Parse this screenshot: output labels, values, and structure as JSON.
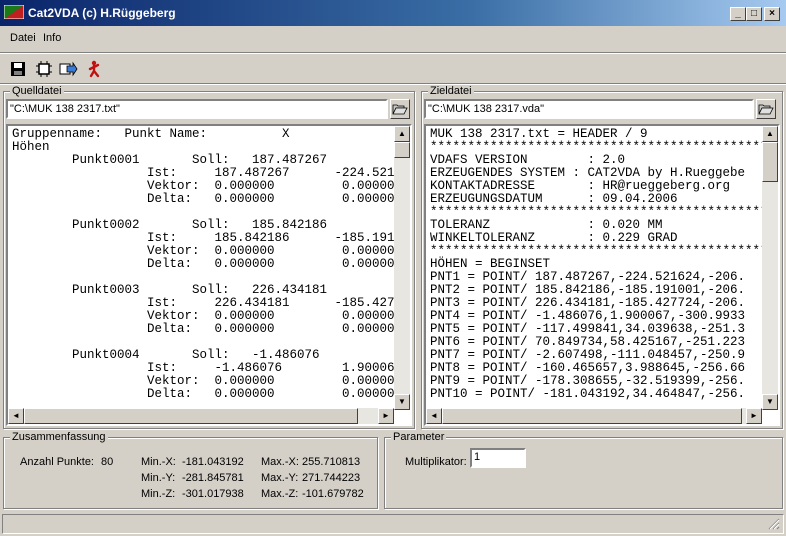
{
  "window": {
    "title": "Cat2VDA (c) H.Rüggeberg"
  },
  "menu": {
    "items": [
      "Datei",
      "Info"
    ]
  },
  "toolbar": {
    "icons": [
      "save-icon",
      "process-icon",
      "convert-icon",
      "exit-icon"
    ]
  },
  "source": {
    "group_label": "Quelldatei",
    "path": "\"C:\\MUK 138 2317.txt\"",
    "lines": [
      "Gruppenname:   Punkt Name:          X",
      "Höhen",
      "        Punkt0001       Soll:   187.487267",
      "                  Ist:     187.487267      -224.521",
      "                  Vektor:  0.000000         0.000000",
      "                  Delta:   0.000000         0.000000",
      "",
      "        Punkt0002       Soll:   185.842186",
      "                  Ist:     185.842186      -185.191",
      "                  Vektor:  0.000000         0.000000",
      "                  Delta:   0.000000         0.000000",
      "",
      "        Punkt0003       Soll:   226.434181",
      "                  Ist:     226.434181      -185.427",
      "                  Vektor:  0.000000         0.000000",
      "                  Delta:   0.000000         0.000000",
      "",
      "        Punkt0004       Soll:   -1.486076",
      "                  Ist:     -1.486076        1.900067",
      "                  Vektor:  0.000000         0.000000",
      "                  Delta:   0.000000         0.000000"
    ]
  },
  "target": {
    "group_label": "Zieldatei",
    "path": "\"C:\\MUK 138 2317.vda\"",
    "lines": [
      "MUK 138 2317.txt = HEADER / 9",
      "*****************************************************",
      "VDAFS VERSION        : 2.0",
      "ERZEUGENDES SYSTEM : CAT2VDA by H.Rueggebe",
      "KONTAKTADRESSE       : HR@rueggeberg.org",
      "ERZEUGUNGSDATUM      : 09.04.2006",
      "*****************************************************",
      "TOLERANZ             : 0.020 MM",
      "WINKELTOLERANZ       : 0.229 GRAD",
      "*****************************************************",
      "HÖHEN = BEGINSET",
      "PNT1 = POINT/ 187.487267,-224.521624,-206.",
      "PNT2 = POINT/ 185.842186,-185.191001,-206.",
      "PNT3 = POINT/ 226.434181,-185.427724,-206.",
      "PNT4 = POINT/ -1.486076,1.900067,-300.9933",
      "PNT5 = POINT/ -117.499841,34.039638,-251.3",
      "PNT6 = POINT/ 70.849734,58.425167,-251.223",
      "PNT7 = POINT/ -2.607498,-111.048457,-250.9",
      "PNT8 = POINT/ -160.465657,3.988645,-256.66",
      "PNT9 = POINT/ -178.308655,-32.519399,-256.",
      "PNT10 = POINT/ -181.043192,34.464847,-256."
    ]
  },
  "summary": {
    "group_label": "Zusammenfassung",
    "count_label": "Anzahl Punkte:",
    "count_value": "80",
    "min_x_label": "Min.-X:",
    "min_x": "-181.043192",
    "min_y_label": "Min.-Y:",
    "min_y": "-281.845781",
    "min_z_label": "Min.-Z:",
    "min_z": "-301.017938",
    "max_x_label": "Max.-X:",
    "max_x": "255.710813",
    "max_y_label": "Max.-Y:",
    "max_y": "271.744223",
    "max_z_label": "Max.-Z:",
    "max_z": "-101.679782"
  },
  "parameter": {
    "group_label": "Parameter",
    "multiplier_label": "Multiplikator:",
    "multiplier_value": "1"
  }
}
